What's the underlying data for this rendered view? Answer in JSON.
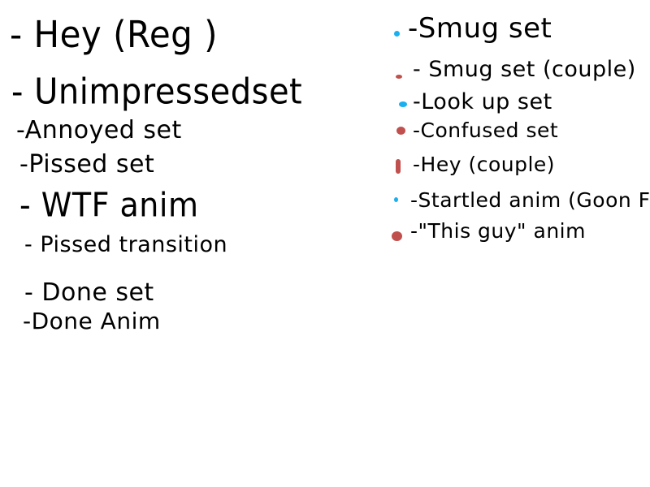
{
  "colors": {
    "ink": "#000000",
    "blue_marker": "#1ab0f0",
    "red_marker": "#c0504d"
  },
  "left_list": [
    {
      "text": "- Hey (Reg )"
    },
    {
      "text": "- Unimpressedset"
    },
    {
      "text": "-Annoyed set"
    },
    {
      "text": "-Pissed set"
    },
    {
      "text": "- WTF anim"
    },
    {
      "text": "- Pissed transition"
    },
    {
      "text": "- Done set"
    },
    {
      "text": "-Done Anim"
    }
  ],
  "right_list": [
    {
      "text": "-Smug set",
      "marker": "blue"
    },
    {
      "text": "- Smug set (couple)",
      "marker": "red"
    },
    {
      "text": "-Look up set",
      "marker": "blue"
    },
    {
      "text": "-Confused set",
      "marker": "red"
    },
    {
      "text": "-Hey (couple)",
      "marker": "red"
    },
    {
      "text": "-Startled anim (Goon Fel",
      "marker": "blue"
    },
    {
      "text": "-\"This guy\" anim",
      "marker": "red"
    }
  ]
}
